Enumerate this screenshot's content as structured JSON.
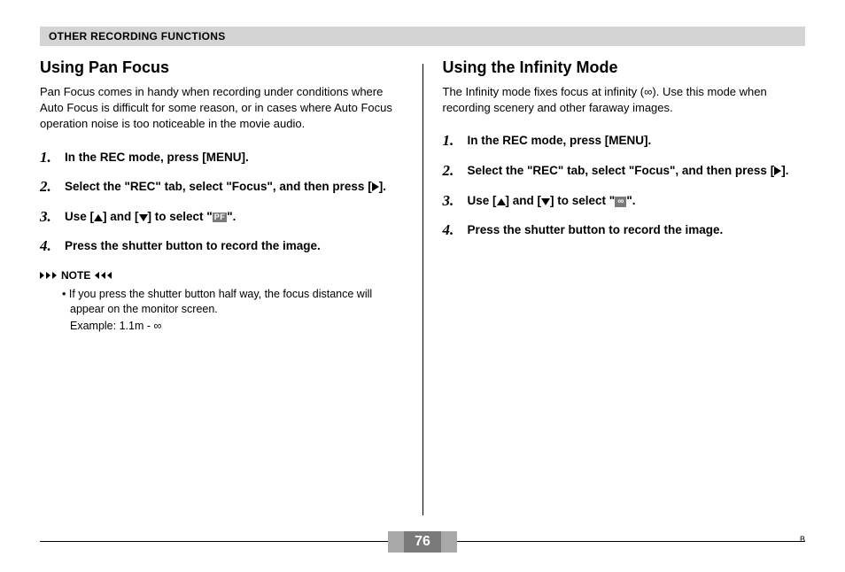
{
  "header": {
    "title": "OTHER RECORDING FUNCTIONS"
  },
  "left": {
    "heading": "Using Pan Focus",
    "intro": "Pan Focus comes in handy when recording under conditions where Auto Focus is difficult for some reason, or in cases where Auto Focus operation noise is too noticeable in the movie audio.",
    "steps": {
      "s1": "In the REC mode, press [MENU].",
      "s2a": "Select the \"REC\" tab, select \"Focus\", and then press [",
      "s2b": "].",
      "s3a": "Use [",
      "s3b": "] and [",
      "s3c": "] to select \"",
      "pf": "PF",
      "s3d": "\".",
      "s4": "Press the shutter button to record the image."
    },
    "note": {
      "label": "NOTE",
      "body": "If you press the shutter button half way, the focus distance will appear on the monitor screen.",
      "example": "Example: 1.1m - ∞"
    }
  },
  "right": {
    "heading": "Using the Infinity Mode",
    "intro_a": "The Infinity mode fixes focus at infinity (",
    "intro_inf": "∞",
    "intro_b": "). Use this mode when recording scenery and other faraway images.",
    "steps": {
      "s1": "In the REC mode, press [MENU].",
      "s2a": "Select the \"REC\" tab, select \"Focus\", and then press [",
      "s2b": "].",
      "s3a": "Use [",
      "s3b": "] and [",
      "s3c": "] to select \"",
      "inf": "∞",
      "s3d": "\".",
      "s4": "Press the shutter button to record the image."
    }
  },
  "footer": {
    "page": "76",
    "mark": "B"
  }
}
